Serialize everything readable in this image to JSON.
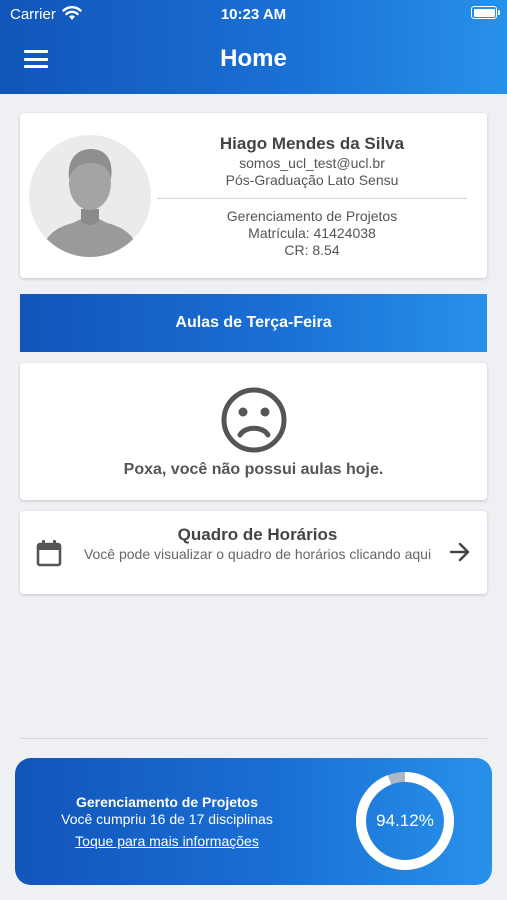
{
  "status_bar": {
    "carrier": "Carrier",
    "time": "10:23 AM"
  },
  "header": {
    "title": "Home"
  },
  "profile": {
    "name": "Hiago Mendes da Silva",
    "email": "somos_ucl_test@ucl.br",
    "program": "Pós-Graduação Lato Sensu",
    "course": "Gerenciamento de Projetos",
    "enrollment": "Matrícula: 41424038",
    "cr": "CR: 8.54"
  },
  "day_banner": {
    "label": "Aulas de Terça-Feira"
  },
  "no_classes": {
    "message": "Poxa, você não possui aulas hoje."
  },
  "schedule": {
    "title": "Quadro de Horários",
    "description": "Você pode visualizar o quadro de horários clicando aqui"
  },
  "progress": {
    "course": "Gerenciamento de Projetos",
    "summary": "Você cumpriu 16 de 17 disciplinas",
    "link": "Toque para mais informações",
    "percent_label": "94.12%",
    "fraction": 0.9412,
    "colors": {
      "track": "#aeb7c2",
      "fill": "#ffffff"
    }
  },
  "icons": [
    "wifi-icon",
    "battery-icon",
    "menu-icon",
    "avatar-placeholder-icon",
    "sad-face-icon",
    "calendar-icon",
    "arrow-right-icon"
  ],
  "colors": {
    "brand_dark": "#1255b9",
    "brand_light": "#2791ea",
    "background": "#eef0f3"
  }
}
